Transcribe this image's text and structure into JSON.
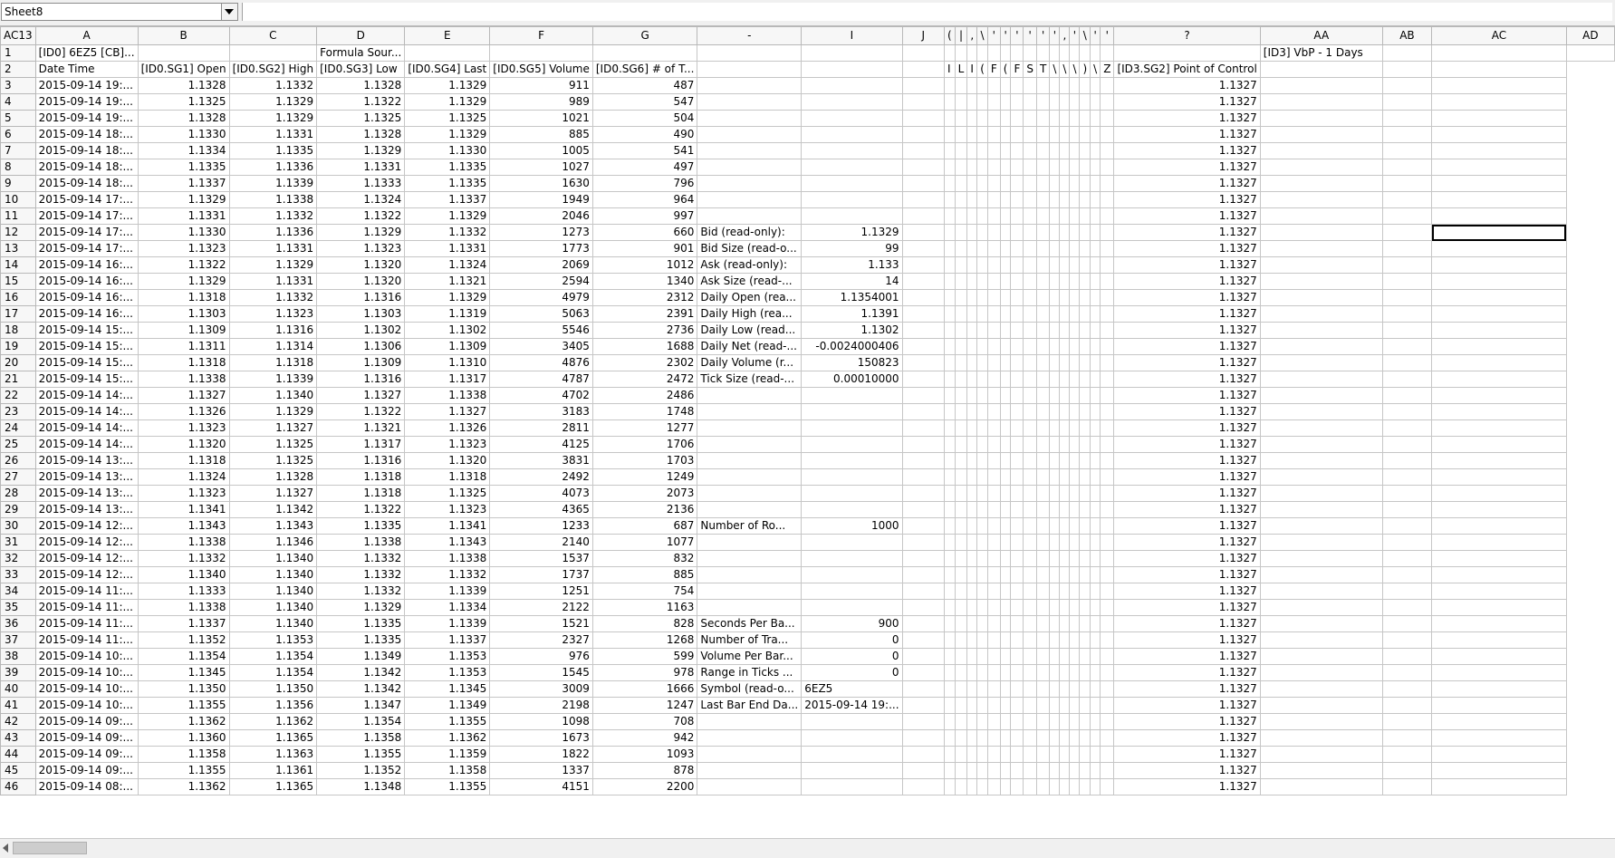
{
  "sheet_selector": {
    "value": "Sheet8"
  },
  "name_box": "AC13",
  "columns": [
    "A",
    "B",
    "C",
    "D",
    "E",
    "F",
    "G",
    "-",
    "I",
    "J",
    "(",
    "|",
    ",",
    "\\",
    "'",
    "'",
    "'",
    "'",
    "'",
    "'",
    ",",
    "'",
    "\\",
    "'",
    "'",
    "?",
    "AA",
    "AB",
    "AC",
    "AD"
  ],
  "rows": [
    [
      "1",
      "[ID0] 6EZ5 [CB]...",
      "",
      "",
      "Formula Sour...",
      "",
      "",
      "",
      "",
      "",
      "",
      "",
      "",
      "",
      "",
      "",
      "",
      "",
      "",
      "",
      "",
      "",
      "",
      "",
      "",
      "",
      "",
      "[ID3] VbP - 1 Days",
      "",
      "",
      ""
    ],
    [
      "2",
      "Date Time",
      "[ID0.SG1] Open",
      "[ID0.SG2] High",
      "[ID0.SG3] Low",
      "[ID0.SG4] Last",
      "[ID0.SG5] Volume",
      "[ID0.SG6] # of T...",
      "",
      "",
      "",
      "I",
      "L",
      "I",
      "(",
      "F",
      "(",
      "F",
      "S",
      "T",
      "\\",
      "\\",
      "\\",
      ")",
      "\\",
      "Z",
      "[ID3.SG2] Point of Control",
      "",
      "",
      ""
    ],
    [
      "3",
      "2015-09-14 19:...",
      "1.1328",
      "1.1332",
      "1.1328",
      "1.1329",
      "911",
      "487",
      "",
      "",
      "",
      "",
      "",
      "",
      "",
      "",
      "",
      "",
      "",
      "",
      "",
      "",
      "",
      "",
      "",
      "",
      "1.1327",
      "",
      "",
      ""
    ],
    [
      "4",
      "2015-09-14 19:...",
      "1.1325",
      "1.1329",
      "1.1322",
      "1.1329",
      "989",
      "547",
      "",
      "",
      "",
      "",
      "",
      "",
      "",
      "",
      "",
      "",
      "",
      "",
      "",
      "",
      "",
      "",
      "",
      "",
      "1.1327",
      "",
      "",
      ""
    ],
    [
      "5",
      "2015-09-14 19:...",
      "1.1328",
      "1.1329",
      "1.1325",
      "1.1325",
      "1021",
      "504",
      "",
      "",
      "",
      "",
      "",
      "",
      "",
      "",
      "",
      "",
      "",
      "",
      "",
      "",
      "",
      "",
      "",
      "",
      "1.1327",
      "",
      "",
      ""
    ],
    [
      "6",
      "2015-09-14 18:...",
      "1.1330",
      "1.1331",
      "1.1328",
      "1.1329",
      "885",
      "490",
      "",
      "",
      "",
      "",
      "",
      "",
      "",
      "",
      "",
      "",
      "",
      "",
      "",
      "",
      "",
      "",
      "",
      "",
      "1.1327",
      "",
      "",
      ""
    ],
    [
      "7",
      "2015-09-14 18:...",
      "1.1334",
      "1.1335",
      "1.1329",
      "1.1330",
      "1005",
      "541",
      "",
      "",
      "",
      "",
      "",
      "",
      "",
      "",
      "",
      "",
      "",
      "",
      "",
      "",
      "",
      "",
      "",
      "",
      "1.1327",
      "",
      "",
      ""
    ],
    [
      "8",
      "2015-09-14 18:...",
      "1.1335",
      "1.1336",
      "1.1331",
      "1.1335",
      "1027",
      "497",
      "",
      "",
      "",
      "",
      "",
      "",
      "",
      "",
      "",
      "",
      "",
      "",
      "",
      "",
      "",
      "",
      "",
      "",
      "1.1327",
      "",
      "",
      ""
    ],
    [
      "9",
      "2015-09-14 18:...",
      "1.1337",
      "1.1339",
      "1.1333",
      "1.1335",
      "1630",
      "796",
      "",
      "",
      "",
      "",
      "",
      "",
      "",
      "",
      "",
      "",
      "",
      "",
      "",
      "",
      "",
      "",
      "",
      "",
      "1.1327",
      "",
      "",
      ""
    ],
    [
      "10",
      "2015-09-14 17:...",
      "1.1329",
      "1.1338",
      "1.1324",
      "1.1337",
      "1949",
      "964",
      "",
      "",
      "",
      "",
      "",
      "",
      "",
      "",
      "",
      "",
      "",
      "",
      "",
      "",
      "",
      "",
      "",
      "",
      "1.1327",
      "",
      "",
      ""
    ],
    [
      "11",
      "2015-09-14 17:...",
      "1.1331",
      "1.1332",
      "1.1322",
      "1.1329",
      "2046",
      "997",
      "",
      "",
      "",
      "",
      "",
      "",
      "",
      "",
      "",
      "",
      "",
      "",
      "",
      "",
      "",
      "",
      "",
      "",
      "1.1327",
      "",
      "",
      ""
    ],
    [
      "12",
      "2015-09-14 17:...",
      "1.1330",
      "1.1336",
      "1.1329",
      "1.1332",
      "1273",
      "660",
      "Bid (read-only):",
      "1.1329",
      "",
      "",
      "",
      "",
      "",
      "",
      "",
      "",
      "",
      "",
      "",
      "",
      "",
      "",
      "",
      "",
      "1.1327",
      "",
      "",
      ""
    ],
    [
      "13",
      "2015-09-14 17:...",
      "1.1323",
      "1.1331",
      "1.1323",
      "1.1331",
      "1773",
      "901",
      "Bid Size (read-o...",
      "99",
      "",
      "",
      "",
      "",
      "",
      "",
      "",
      "",
      "",
      "",
      "",
      "",
      "",
      "",
      "",
      "",
      "1.1327",
      "",
      "",
      ""
    ],
    [
      "14",
      "2015-09-14 16:...",
      "1.1322",
      "1.1329",
      "1.1320",
      "1.1324",
      "2069",
      "1012",
      "Ask (read-only):",
      "1.133",
      "",
      "",
      "",
      "",
      "",
      "",
      "",
      "",
      "",
      "",
      "",
      "",
      "",
      "",
      "",
      "",
      "1.1327",
      "",
      "",
      ""
    ],
    [
      "15",
      "2015-09-14 16:...",
      "1.1329",
      "1.1331",
      "1.1320",
      "1.1321",
      "2594",
      "1340",
      "Ask Size (read-...",
      "14",
      "",
      "",
      "",
      "",
      "",
      "",
      "",
      "",
      "",
      "",
      "",
      "",
      "",
      "",
      "",
      "",
      "1.1327",
      "",
      "",
      ""
    ],
    [
      "16",
      "2015-09-14 16:...",
      "1.1318",
      "1.1332",
      "1.1316",
      "1.1329",
      "4979",
      "2312",
      "Daily Open (rea...",
      "1.1354001",
      "",
      "",
      "",
      "",
      "",
      "",
      "",
      "",
      "",
      "",
      "",
      "",
      "",
      "",
      "",
      "",
      "1.1327",
      "",
      "",
      ""
    ],
    [
      "17",
      "2015-09-14 16:...",
      "1.1303",
      "1.1323",
      "1.1303",
      "1.1319",
      "5063",
      "2391",
      "Daily High (rea...",
      "1.1391",
      "",
      "",
      "",
      "",
      "",
      "",
      "",
      "",
      "",
      "",
      "",
      "",
      "",
      "",
      "",
      "",
      "1.1327",
      "",
      "",
      ""
    ],
    [
      "18",
      "2015-09-14 15:...",
      "1.1309",
      "1.1316",
      "1.1302",
      "1.1302",
      "5546",
      "2736",
      "Daily Low (read...",
      "1.1302",
      "",
      "",
      "",
      "",
      "",
      "",
      "",
      "",
      "",
      "",
      "",
      "",
      "",
      "",
      "",
      "",
      "1.1327",
      "",
      "",
      ""
    ],
    [
      "19",
      "2015-09-14 15:...",
      "1.1311",
      "1.1314",
      "1.1306",
      "1.1309",
      "3405",
      "1688",
      "Daily Net (read-...",
      "-0.0024000406",
      "",
      "",
      "",
      "",
      "",
      "",
      "",
      "",
      "",
      "",
      "",
      "",
      "",
      "",
      "",
      "",
      "1.1327",
      "",
      "",
      ""
    ],
    [
      "20",
      "2015-09-14 15:...",
      "1.1318",
      "1.1318",
      "1.1309",
      "1.1310",
      "4876",
      "2302",
      "Daily Volume (r...",
      "150823",
      "",
      "",
      "",
      "",
      "",
      "",
      "",
      "",
      "",
      "",
      "",
      "",
      "",
      "",
      "",
      "",
      "1.1327",
      "",
      "",
      ""
    ],
    [
      "21",
      "2015-09-14 15:...",
      "1.1338",
      "1.1339",
      "1.1316",
      "1.1317",
      "4787",
      "2472",
      "Tick Size (read-...",
      "0.00010000",
      "",
      "",
      "",
      "",
      "",
      "",
      "",
      "",
      "",
      "",
      "",
      "",
      "",
      "",
      "",
      "",
      "1.1327",
      "",
      "",
      ""
    ],
    [
      "22",
      "2015-09-14 14:...",
      "1.1327",
      "1.1340",
      "1.1327",
      "1.1338",
      "4702",
      "2486",
      "",
      "",
      "",
      "",
      "",
      "",
      "",
      "",
      "",
      "",
      "",
      "",
      "",
      "",
      "",
      "",
      "",
      "",
      "1.1327",
      "",
      "",
      ""
    ],
    [
      "23",
      "2015-09-14 14:...",
      "1.1326",
      "1.1329",
      "1.1322",
      "1.1327",
      "3183",
      "1748",
      "",
      "",
      "",
      "",
      "",
      "",
      "",
      "",
      "",
      "",
      "",
      "",
      "",
      "",
      "",
      "",
      "",
      "",
      "1.1327",
      "",
      "",
      ""
    ],
    [
      "24",
      "2015-09-14 14:...",
      "1.1323",
      "1.1327",
      "1.1321",
      "1.1326",
      "2811",
      "1277",
      "",
      "",
      "",
      "",
      "",
      "",
      "",
      "",
      "",
      "",
      "",
      "",
      "",
      "",
      "",
      "",
      "",
      "",
      "1.1327",
      "",
      "",
      ""
    ],
    [
      "25",
      "2015-09-14 14:...",
      "1.1320",
      "1.1325",
      "1.1317",
      "1.1323",
      "4125",
      "1706",
      "",
      "",
      "",
      "",
      "",
      "",
      "",
      "",
      "",
      "",
      "",
      "",
      "",
      "",
      "",
      "",
      "",
      "",
      "1.1327",
      "",
      "",
      ""
    ],
    [
      "26",
      "2015-09-14 13:...",
      "1.1318",
      "1.1325",
      "1.1316",
      "1.1320",
      "3831",
      "1703",
      "",
      "",
      "",
      "",
      "",
      "",
      "",
      "",
      "",
      "",
      "",
      "",
      "",
      "",
      "",
      "",
      "",
      "",
      "1.1327",
      "",
      "",
      ""
    ],
    [
      "27",
      "2015-09-14 13:...",
      "1.1324",
      "1.1328",
      "1.1318",
      "1.1318",
      "2492",
      "1249",
      "",
      "",
      "",
      "",
      "",
      "",
      "",
      "",
      "",
      "",
      "",
      "",
      "",
      "",
      "",
      "",
      "",
      "",
      "1.1327",
      "",
      "",
      ""
    ],
    [
      "28",
      "2015-09-14 13:...",
      "1.1323",
      "1.1327",
      "1.1318",
      "1.1325",
      "4073",
      "2073",
      "",
      "",
      "",
      "",
      "",
      "",
      "",
      "",
      "",
      "",
      "",
      "",
      "",
      "",
      "",
      "",
      "",
      "",
      "1.1327",
      "",
      "",
      ""
    ],
    [
      "29",
      "2015-09-14 13:...",
      "1.1341",
      "1.1342",
      "1.1322",
      "1.1323",
      "4365",
      "2136",
      "",
      "",
      "",
      "",
      "",
      "",
      "",
      "",
      "",
      "",
      "",
      "",
      "",
      "",
      "",
      "",
      "",
      "",
      "1.1327",
      "",
      "",
      ""
    ],
    [
      "30",
      "2015-09-14 12:...",
      "1.1343",
      "1.1343",
      "1.1335",
      "1.1341",
      "1233",
      "687",
      "Number of Ro...",
      "1000",
      "",
      "",
      "",
      "",
      "",
      "",
      "",
      "",
      "",
      "",
      "",
      "",
      "",
      "",
      "",
      "",
      "1.1327",
      "",
      "",
      ""
    ],
    [
      "31",
      "2015-09-14 12:...",
      "1.1338",
      "1.1346",
      "1.1338",
      "1.1343",
      "2140",
      "1077",
      "",
      "",
      "",
      "",
      "",
      "",
      "",
      "",
      "",
      "",
      "",
      "",
      "",
      "",
      "",
      "",
      "",
      "",
      "1.1327",
      "",
      "",
      ""
    ],
    [
      "32",
      "2015-09-14 12:...",
      "1.1332",
      "1.1340",
      "1.1332",
      "1.1338",
      "1537",
      "832",
      "",
      "",
      "",
      "",
      "",
      "",
      "",
      "",
      "",
      "",
      "",
      "",
      "",
      "",
      "",
      "",
      "",
      "",
      "1.1327",
      "",
      "",
      ""
    ],
    [
      "33",
      "2015-09-14 12:...",
      "1.1340",
      "1.1340",
      "1.1332",
      "1.1332",
      "1737",
      "885",
      "",
      "",
      "",
      "",
      "",
      "",
      "",
      "",
      "",
      "",
      "",
      "",
      "",
      "",
      "",
      "",
      "",
      "",
      "1.1327",
      "",
      "",
      ""
    ],
    [
      "34",
      "2015-09-14 11:...",
      "1.1333",
      "1.1340",
      "1.1332",
      "1.1339",
      "1251",
      "754",
      "",
      "",
      "",
      "",
      "",
      "",
      "",
      "",
      "",
      "",
      "",
      "",
      "",
      "",
      "",
      "",
      "",
      "",
      "1.1327",
      "",
      "",
      ""
    ],
    [
      "35",
      "2015-09-14 11:...",
      "1.1338",
      "1.1340",
      "1.1329",
      "1.1334",
      "2122",
      "1163",
      "",
      "",
      "",
      "",
      "",
      "",
      "",
      "",
      "",
      "",
      "",
      "",
      "",
      "",
      "",
      "",
      "",
      "",
      "1.1327",
      "",
      "",
      ""
    ],
    [
      "36",
      "2015-09-14 11:...",
      "1.1337",
      "1.1340",
      "1.1335",
      "1.1339",
      "1521",
      "828",
      "Seconds Per Ba...",
      "900",
      "",
      "",
      "",
      "",
      "",
      "",
      "",
      "",
      "",
      "",
      "",
      "",
      "",
      "",
      "",
      "",
      "1.1327",
      "",
      "",
      ""
    ],
    [
      "37",
      "2015-09-14 11:...",
      "1.1352",
      "1.1353",
      "1.1335",
      "1.1337",
      "2327",
      "1268",
      "Number of Tra...",
      "0",
      "",
      "",
      "",
      "",
      "",
      "",
      "",
      "",
      "",
      "",
      "",
      "",
      "",
      "",
      "",
      "",
      "1.1327",
      "",
      "",
      ""
    ],
    [
      "38",
      "2015-09-14 10:...",
      "1.1354",
      "1.1354",
      "1.1349",
      "1.1353",
      "976",
      "599",
      "Volume Per Bar...",
      "0",
      "",
      "",
      "",
      "",
      "",
      "",
      "",
      "",
      "",
      "",
      "",
      "",
      "",
      "",
      "",
      "",
      "1.1327",
      "",
      "",
      ""
    ],
    [
      "39",
      "2015-09-14 10:...",
      "1.1345",
      "1.1354",
      "1.1342",
      "1.1353",
      "1545",
      "978",
      "Range in Ticks ...",
      "0",
      "",
      "",
      "",
      "",
      "",
      "",
      "",
      "",
      "",
      "",
      "",
      "",
      "",
      "",
      "",
      "",
      "1.1327",
      "",
      "",
      ""
    ],
    [
      "40",
      "2015-09-14 10:...",
      "1.1350",
      "1.1350",
      "1.1342",
      "1.1345",
      "3009",
      "1666",
      "Symbol (read-o...",
      "6EZ5",
      "",
      "",
      "",
      "",
      "",
      "",
      "",
      "",
      "",
      "",
      "",
      "",
      "",
      "",
      "",
      "",
      "1.1327",
      "",
      "",
      ""
    ],
    [
      "41",
      "2015-09-14 10:...",
      "1.1355",
      "1.1356",
      "1.1347",
      "1.1349",
      "2198",
      "1247",
      "Last Bar End Da...",
      "2015-09-14 19:...",
      "",
      "",
      "",
      "",
      "",
      "",
      "",
      "",
      "",
      "",
      "",
      "",
      "",
      "",
      "",
      "",
      "1.1327",
      "",
      "",
      ""
    ],
    [
      "42",
      "2015-09-14 09:...",
      "1.1362",
      "1.1362",
      "1.1354",
      "1.1355",
      "1098",
      "708",
      "",
      "",
      "",
      "",
      "",
      "",
      "",
      "",
      "",
      "",
      "",
      "",
      "",
      "",
      "",
      "",
      "",
      "",
      "1.1327",
      "",
      "",
      ""
    ],
    [
      "43",
      "2015-09-14 09:...",
      "1.1360",
      "1.1365",
      "1.1358",
      "1.1362",
      "1673",
      "942",
      "",
      "",
      "",
      "",
      "",
      "",
      "",
      "",
      "",
      "",
      "",
      "",
      "",
      "",
      "",
      "",
      "",
      "",
      "1.1327",
      "",
      "",
      ""
    ],
    [
      "44",
      "2015-09-14 09:...",
      "1.1358",
      "1.1363",
      "1.1355",
      "1.1359",
      "1822",
      "1093",
      "",
      "",
      "",
      "",
      "",
      "",
      "",
      "",
      "",
      "",
      "",
      "",
      "",
      "",
      "",
      "",
      "",
      "",
      "1.1327",
      "",
      "",
      ""
    ],
    [
      "45",
      "2015-09-14 09:...",
      "1.1355",
      "1.1361",
      "1.1352",
      "1.1358",
      "1337",
      "878",
      "",
      "",
      "",
      "",
      "",
      "",
      "",
      "",
      "",
      "",
      "",
      "",
      "",
      "",
      "",
      "",
      "",
      "",
      "1.1327",
      "",
      "",
      ""
    ],
    [
      "46",
      "2015-09-14 08:...",
      "1.1362",
      "1.1365",
      "1.1348",
      "1.1355",
      "4151",
      "2200",
      "",
      "",
      "",
      "",
      "",
      "",
      "",
      "",
      "",
      "",
      "",
      "",
      "",
      "",
      "",
      "",
      "",
      "",
      "1.1327",
      "",
      "",
      ""
    ]
  ]
}
